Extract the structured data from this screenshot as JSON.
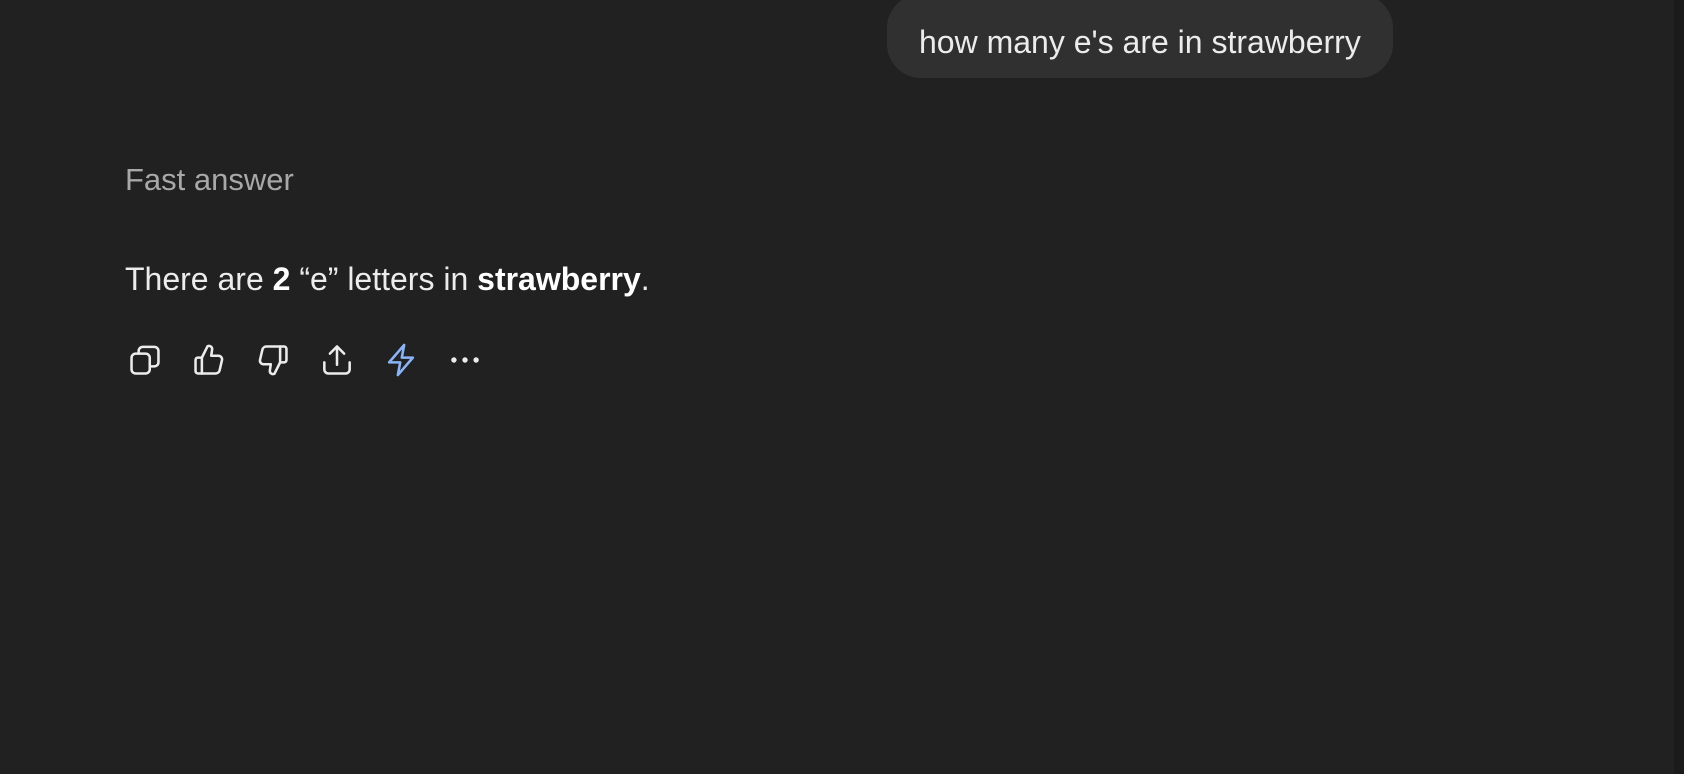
{
  "conversation": {
    "user_message": "how many e's are in strawberry",
    "response_label": "Fast answer",
    "response": {
      "prefix": "There are ",
      "count": "2",
      "middle": " “e” letters in ",
      "word": "strawberry",
      "suffix": "."
    }
  },
  "actions": [
    {
      "icon": "copy-icon"
    },
    {
      "icon": "thumbs-up-icon"
    },
    {
      "icon": "thumbs-down-icon"
    },
    {
      "icon": "share-icon"
    },
    {
      "icon": "lightning-icon",
      "color": "#8ab4f8"
    },
    {
      "icon": "more-options-icon"
    }
  ],
  "colors": {
    "background": "#212121",
    "user_bubble": "#303030",
    "text": "#ececec",
    "label": "#a8a8a8",
    "accent": "#8ab4f8"
  }
}
